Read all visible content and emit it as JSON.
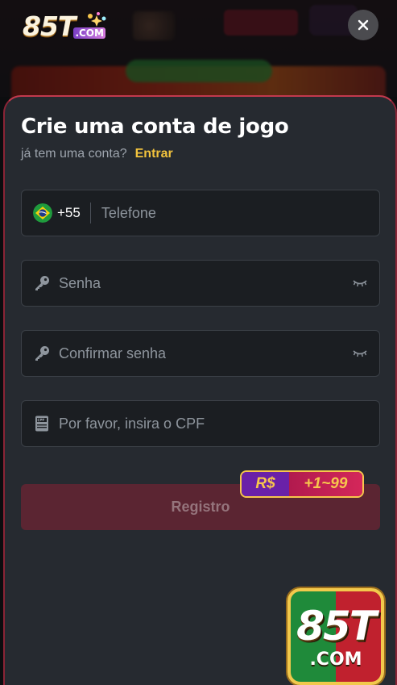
{
  "header": {
    "logo_main": "85T",
    "logo_com": ".COM"
  },
  "modal": {
    "title": "Crie uma conta de jogo",
    "subtitle": "já tem uma conta?",
    "login_link": "Entrar",
    "phone": {
      "dial_code": "+55",
      "placeholder": "Telefone",
      "flag_icon": "brazil-flag-icon"
    },
    "password": {
      "placeholder": "Senha",
      "icon": "key-icon"
    },
    "confirm_password": {
      "placeholder": "Confirmar senha",
      "icon": "key-icon"
    },
    "cpf": {
      "placeholder": "Por favor, insira o CPF",
      "icon": "cpf-card-icon"
    },
    "register_label": "Registro",
    "bonus": {
      "currency": "R$",
      "range": "+1~99"
    }
  },
  "corner_logo": {
    "main": "85T",
    "com": ".COM"
  },
  "colors": {
    "accent_gold": "#f2c33d",
    "register_bg": "#5b2532",
    "modal_bg": "#262a30"
  }
}
